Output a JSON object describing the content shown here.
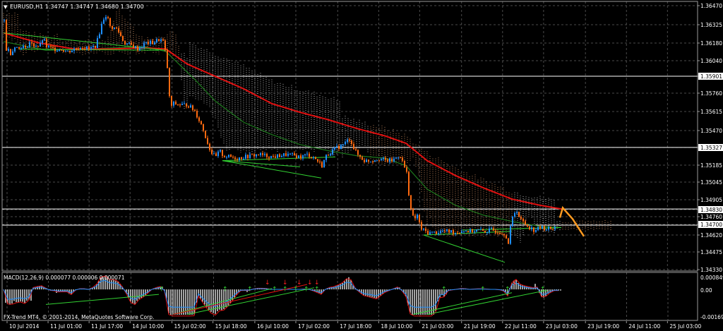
{
  "header": {
    "title": "EURUSD,H1  1.34747 1.34747 1.34680 1.34700",
    "dropdown_glyph": "▼"
  },
  "macd": {
    "title": "MACD(12,26,9) 0.000077 0.000006 0.000071",
    "price_labels": [
      "0.000849",
      "0.00",
      "-0.001691"
    ]
  },
  "copyright": "FX-Trend MT4, © 2001-2014, MetaQuotes Software Corp.",
  "colors": {
    "background": "#000000",
    "grid": "#4a4a4a",
    "bull": "#1e90ff",
    "bear": "#ff6a10",
    "ma_red": "#e01010",
    "ma_green": "#1e7a1e",
    "trend_green": "#32d232",
    "cloud_bear": "#ffb07a",
    "cloud_bull": "#ffffff",
    "forecast": "#ff9a20",
    "horizontal": "#ffffff"
  },
  "chart_data": {
    "type": "candlestick",
    "symbol": "EURUSD",
    "timeframe": "H1",
    "ohlc_last": {
      "open": 1.34747,
      "high": 1.34747,
      "low": 1.3468,
      "close": 1.347
    },
    "y_axis_labels": [
      "1.36470",
      "1.36325",
      "1.36180",
      "1.36040",
      "1.35901",
      "1.35760",
      "1.35615",
      "1.35470",
      "1.35327",
      "1.35185",
      "1.35045",
      "1.34905",
      "1.34830",
      "1.34760",
      "1.34700",
      "1.34620",
      "1.34475",
      "1.34330"
    ],
    "highlighted_levels": [
      1.35901,
      1.35327,
      1.3483,
      1.347
    ],
    "x_axis_labels": [
      "10 Jul 2014",
      "11 Jul 01:00",
      "11 Jul 17:00",
      "14 Jul 10:00",
      "15 Jul 02:00",
      "15 Jul 18:00",
      "16 Jul 10:00",
      "17 Jul 02:00",
      "17 Jul 18:00",
      "18 Jul 10:00",
      "21 Jul 03:00",
      "21 Jul 19:00",
      "22 Jul 11:00",
      "23 Jul 03:00",
      "23 Jul 19:00",
      "24 Jul 11:00",
      "25 Jul 03:00"
    ],
    "ylim": [
      1.3433,
      1.3647
    ],
    "price_path": [
      [
        0,
        1.3635
      ],
      [
        1,
        1.3612
      ],
      [
        5,
        1.3612
      ],
      [
        10,
        1.3608
      ],
      [
        15,
        1.3615
      ],
      [
        20,
        1.3612
      ],
      [
        25,
        1.3615
      ],
      [
        30,
        1.3612
      ],
      [
        35,
        1.3618
      ],
      [
        40,
        1.3615
      ],
      [
        45,
        1.3615
      ],
      [
        50,
        1.3614
      ],
      [
        55,
        1.3621
      ],
      [
        60,
        1.3614
      ],
      [
        70,
        1.3612
      ],
      [
        80,
        1.3612
      ],
      [
        90,
        1.361
      ],
      [
        100,
        1.3612
      ],
      [
        110,
        1.3614
      ],
      [
        120,
        1.3612
      ],
      [
        130,
        1.3615
      ],
      [
        140,
        1.3636
      ],
      [
        145,
        1.364
      ],
      [
        150,
        1.363
      ],
      [
        160,
        1.3628
      ],
      [
        170,
        1.3617
      ],
      [
        180,
        1.3615
      ],
      [
        190,
        1.3612
      ],
      [
        200,
        1.3617
      ],
      [
        210,
        1.3617
      ],
      [
        220,
        1.362
      ],
      [
        225,
        1.3618
      ],
      [
        230,
        1.3605
      ],
      [
        235,
        1.3565
      ],
      [
        240,
        1.3568
      ],
      [
        250,
        1.3567
      ],
      [
        260,
        1.3567
      ],
      [
        270,
        1.3562
      ],
      [
        280,
        1.355
      ],
      [
        290,
        1.3533
      ],
      [
        295,
        1.3527
      ],
      [
        300,
        1.3525
      ],
      [
        305,
        1.353
      ],
      [
        310,
        1.3526
      ],
      [
        320,
        1.3525
      ],
      [
        330,
        1.3524
      ],
      [
        340,
        1.3525
      ],
      [
        350,
        1.3526
      ],
      [
        360,
        1.3527
      ],
      [
        370,
        1.3526
      ],
      [
        380,
        1.3525
      ],
      [
        390,
        1.3526
      ],
      [
        400,
        1.3527
      ],
      [
        410,
        1.3526
      ],
      [
        420,
        1.3525
      ],
      [
        430,
        1.3527
      ],
      [
        440,
        1.3524
      ],
      [
        450,
        1.3518
      ],
      [
        455,
        1.3525
      ],
      [
        460,
        1.3528
      ],
      [
        470,
        1.3532
      ],
      [
        480,
        1.3535
      ],
      [
        490,
        1.354
      ],
      [
        495,
        1.3532
      ],
      [
        500,
        1.3527
      ],
      [
        510,
        1.3522
      ],
      [
        520,
        1.3522
      ],
      [
        530,
        1.3524
      ],
      [
        540,
        1.3522
      ],
      [
        550,
        1.3522
      ],
      [
        560,
        1.3527
      ],
      [
        570,
        1.3512
      ],
      [
        575,
        1.3485
      ],
      [
        580,
        1.3474
      ],
      [
        585,
        1.3478
      ],
      [
        590,
        1.3467
      ],
      [
        600,
        1.3464
      ],
      [
        610,
        1.3464
      ],
      [
        620,
        1.3465
      ],
      [
        630,
        1.3465
      ],
      [
        640,
        1.3464
      ],
      [
        650,
        1.3466
      ],
      [
        660,
        1.3465
      ],
      [
        670,
        1.3466
      ],
      [
        680,
        1.3465
      ],
      [
        690,
        1.3466
      ],
      [
        700,
        1.3465
      ],
      [
        710,
        1.3463
      ],
      [
        714,
        1.3455
      ],
      [
        718,
        1.3472
      ],
      [
        722,
        1.348
      ],
      [
        726,
        1.3482
      ],
      [
        730,
        1.3475
      ],
      [
        740,
        1.347
      ],
      [
        750,
        1.3466
      ],
      [
        760,
        1.3468
      ],
      [
        770,
        1.3467
      ],
      [
        780,
        1.3468
      ]
    ],
    "ma_red": [
      [
        0,
        1.3625
      ],
      [
        50,
        1.3617
      ],
      [
        100,
        1.3612
      ],
      [
        150,
        1.3612
      ],
      [
        200,
        1.3613
      ],
      [
        230,
        1.3612
      ],
      [
        260,
        1.36
      ],
      [
        300,
        1.359
      ],
      [
        340,
        1.358
      ],
      [
        380,
        1.3568
      ],
      [
        420,
        1.3561
      ],
      [
        460,
        1.3555
      ],
      [
        500,
        1.3548
      ],
      [
        540,
        1.3542
      ],
      [
        570,
        1.3536
      ],
      [
        600,
        1.3522
      ],
      [
        640,
        1.351
      ],
      [
        680,
        1.35
      ],
      [
        720,
        1.3491
      ],
      [
        760,
        1.3486
      ],
      [
        790,
        1.3483
      ]
    ],
    "ma_green": [
      [
        0,
        1.3618
      ],
      [
        60,
        1.3611
      ],
      [
        120,
        1.3612
      ],
      [
        200,
        1.3614
      ],
      [
        230,
        1.361
      ],
      [
        270,
        1.3588
      ],
      [
        300,
        1.357
      ],
      [
        340,
        1.3553
      ],
      [
        380,
        1.3543
      ],
      [
        420,
        1.3535
      ],
      [
        460,
        1.353
      ],
      [
        500,
        1.3526
      ],
      [
        540,
        1.3524
      ],
      [
        570,
        1.3518
      ],
      [
        600,
        1.3499
      ],
      [
        640,
        1.3486
      ],
      [
        680,
        1.3478
      ],
      [
        720,
        1.3473
      ],
      [
        760,
        1.3469
      ],
      [
        790,
        1.3468
      ]
    ],
    "forecast": [
      [
        788,
        1.3476
      ],
      [
        792,
        1.3484
      ],
      [
        806,
        1.3475
      ],
      [
        822,
        1.3461
      ]
    ],
    "macd_ylim": [
      -0.001691,
      0.000849
    ]
  }
}
